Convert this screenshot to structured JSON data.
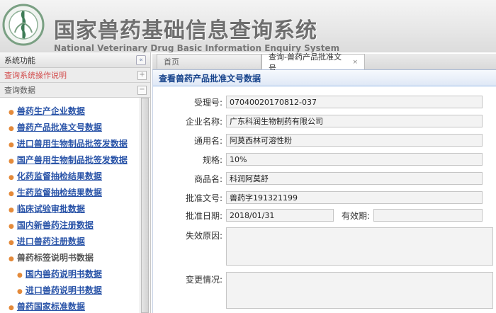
{
  "header": {
    "title_cn": "国家兽药基础信息查询系统",
    "title_en": "National Veterinary Drug Basic Information Enquiry System"
  },
  "left_panel": {
    "title": "系统功能",
    "collapse_symbol": "«",
    "sec1_label": "查询系统操作说明",
    "sec1_toggle": "+",
    "sec2_label": "查询数据",
    "sec2_toggle": "−",
    "menu": [
      "兽药生产企业数据",
      "兽药产品批准文号数据",
      "进口兽用生物制品批签发数据",
      "国产兽用生物制品批签发数据",
      "化药监督抽检结果数据",
      "生药监督抽检结果数据",
      "临床试验审批数据",
      "国内新兽药注册数据",
      "进口兽药注册数据",
      "兽药标签说明书数据",
      "国内兽药说明书数据",
      "进口兽药说明书数据",
      "兽药国家标准数据"
    ]
  },
  "tabs": [
    {
      "label": "首页"
    },
    {
      "label": "查询-兽药产品批准文号",
      "close": "×"
    }
  ],
  "content": {
    "section_title": "查看兽药产品批准文号数据",
    "fields": {
      "accept_no": {
        "label": "受理号:",
        "value": "07040020170812-037"
      },
      "company": {
        "label": "企业名称:",
        "value": "广东科润生物制药有限公司"
      },
      "generic_name": {
        "label": "通用名:",
        "value": "阿莫西林可溶性粉"
      },
      "spec": {
        "label": "规格:",
        "value": "10%"
      },
      "trade_name": {
        "label": "商品名:",
        "value": "科润阿莫舒"
      },
      "approval_no": {
        "label": "批准文号:",
        "value": "兽药字191321199"
      },
      "approval_date": {
        "label": "批准日期:",
        "value": "2018/01/31"
      },
      "valid_until": {
        "label": "有效期:",
        "value": ""
      },
      "invalid_reason": {
        "label": "失效原因:",
        "value": ""
      },
      "change_info": {
        "label": "变更情况:",
        "value": ""
      }
    }
  },
  "colors": {
    "section_title_text": "#15428b",
    "menu_link": "#2a54a8",
    "bullet": "#e48a3a",
    "operation_guide": "#d24a4a"
  }
}
